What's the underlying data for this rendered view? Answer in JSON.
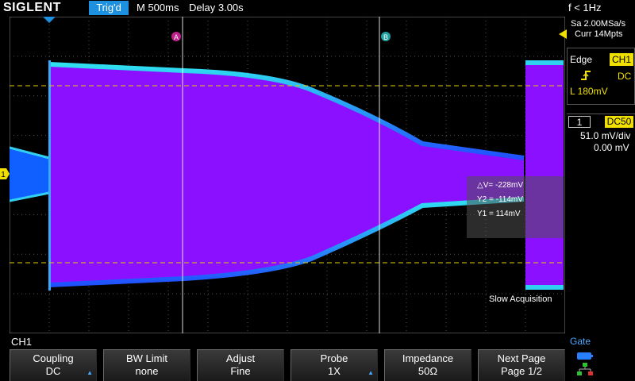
{
  "header": {
    "brand": "SIGLENT",
    "trigger_status": "Trig'd",
    "timebase": "M 500ms",
    "delay": "Delay 3.00s",
    "frequency": "f < 1Hz"
  },
  "acquisition": {
    "sample_rate": "Sa 2.00MSa/s",
    "memory_depth": "Curr 14Mpts",
    "mode_message": "Slow Acquisition"
  },
  "trigger": {
    "type": "Edge",
    "source": "CH1",
    "slope_icon": "rising-edge-icon",
    "coupling": "DC",
    "level": "L   180mV"
  },
  "channel": {
    "number": "1",
    "impedance_badge": "DC50",
    "scale": "51.0 mV/div",
    "offset": "0.00 mV",
    "color": "#f0e000",
    "marker": "1"
  },
  "cursors": {
    "a_label": "A",
    "b_label": "B",
    "delta_v": "△V= -228mV",
    "y2": "Y2 = -114mV",
    "y1": "Y1 = 114mV",
    "a_color": "#c0208c",
    "b_color": "#20a0a0"
  },
  "menu": {
    "title": "CH1",
    "gate_label": "Gate",
    "items": [
      {
        "label": "Coupling",
        "value": "DC",
        "has_arrow": true
      },
      {
        "label": "BW Limit",
        "value": "none",
        "has_arrow": false
      },
      {
        "label": "Adjust",
        "value": "Fine",
        "has_arrow": false
      },
      {
        "label": "Probe",
        "value": "1X",
        "has_arrow": true
      },
      {
        "label": "Impedance",
        "value": "50Ω",
        "has_arrow": false
      },
      {
        "label": "Next Page",
        "value": "Page 1/2",
        "has_arrow": false
      }
    ]
  },
  "colors": {
    "accent": "#1e90e0",
    "trace": "#8a10ff",
    "trace_edge": "#30d0f0",
    "cursor_line": "#e0d000"
  }
}
